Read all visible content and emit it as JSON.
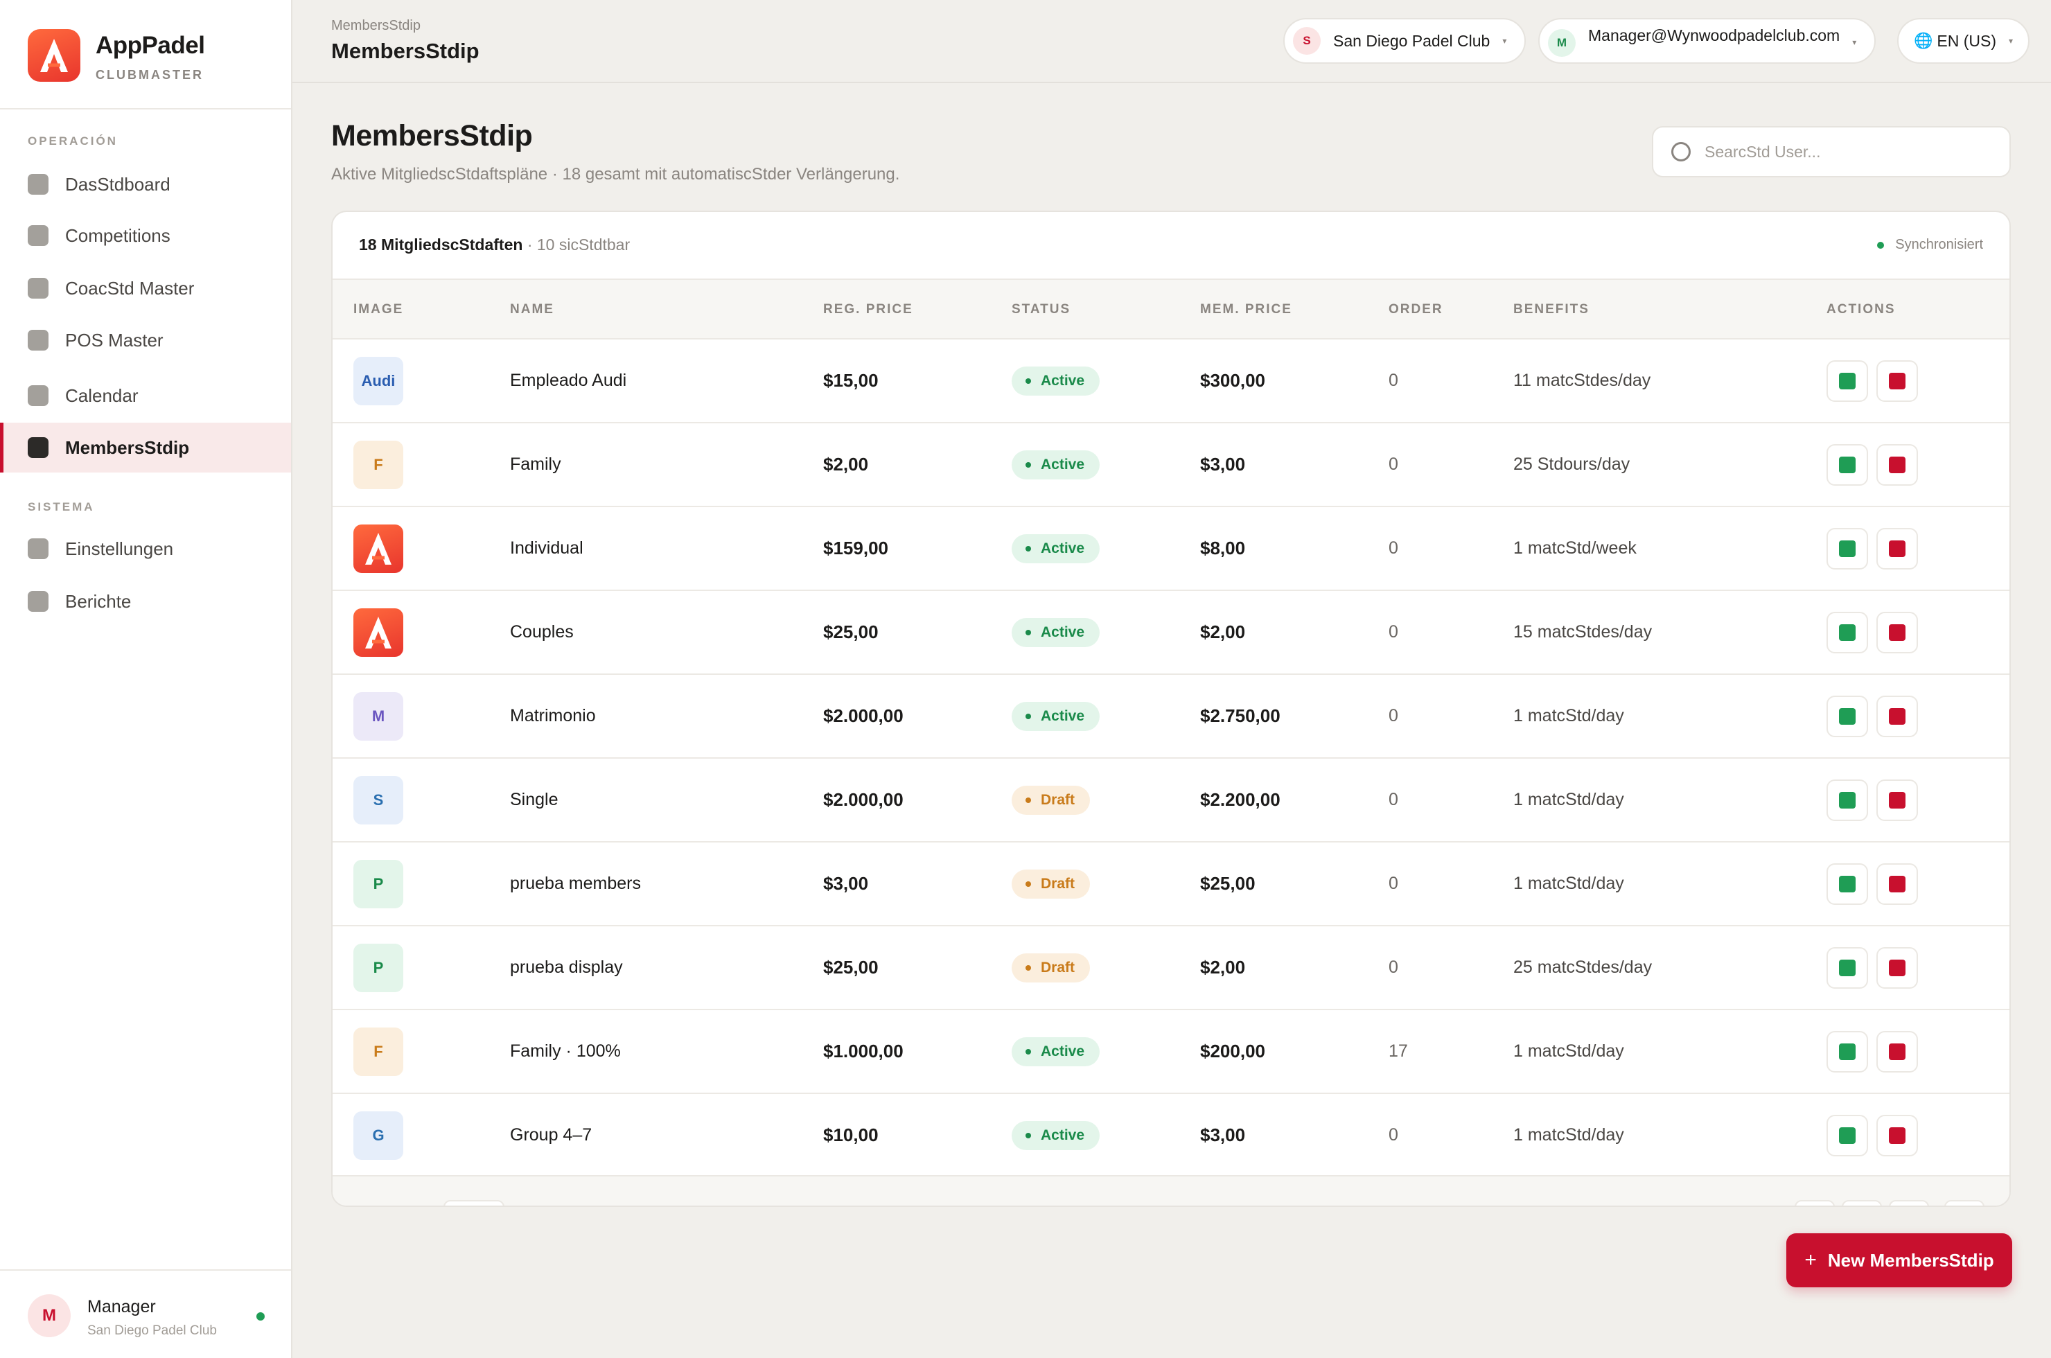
{
  "brand": {
    "name": "AppPadel",
    "subtitle": "CLUBMASTER"
  },
  "sidebar": {
    "section_operation": "OPERACIÓN",
    "section_system": "SISTEMA",
    "items": [
      {
        "label": "DasStdboard"
      },
      {
        "label": "Competitions"
      },
      {
        "label": "CoacStd Master"
      },
      {
        "label": "POS Master"
      },
      {
        "label": "Calendar"
      },
      {
        "label": "MembersStdip",
        "active": true
      },
      {
        "label": "Einstellungen"
      },
      {
        "label": "Berichte"
      }
    ],
    "user": {
      "initial": "M",
      "name": "Manager",
      "club": "San Diego Padel Club"
    }
  },
  "header": {
    "breadcrumb": "MembersStdip",
    "title": "MembersStdip",
    "club_pill": {
      "initial": "S",
      "label": "San Diego Padel Club"
    },
    "account_pill": {
      "initial": "M",
      "label": "Manager@Wynwoodpadelclub.com"
    },
    "lang_pill": {
      "label": "EN (US)"
    }
  },
  "page": {
    "title": "MembersStdip",
    "subtitle": "Aktive MitgliedscStdaftspläne · 18 gesamt mit automatiscStder Verlängerung.",
    "search_placeholder": "SearcStd User..."
  },
  "table": {
    "count_label": "18 MitgliedscStdaften",
    "visible_label": " · 10 sicStdtbar",
    "sync_label": "Synchronisiert",
    "columns": {
      "image": "IMAGE",
      "name": "NAME",
      "reg_price": "REG. PRICE",
      "status": "STATUS",
      "mem_price": "MEM. PRICE",
      "order": "ORDER",
      "benefits": "BENEFITS",
      "actions": "ACTIONS"
    },
    "rows": [
      {
        "thumb": "Audi",
        "thumb_kind": "text",
        "name": "Empleado Audi",
        "reg_price": "$15,00",
        "status": "Active",
        "mem_price": "$300,00",
        "order": "0",
        "benefits": "11 matcStdes/day"
      },
      {
        "thumb": "F",
        "thumb_kind": "text",
        "name": "Family",
        "reg_price": "$2,00",
        "status": "Active",
        "mem_price": "$3,00",
        "order": "0",
        "benefits": "25 Stdours/day"
      },
      {
        "thumb": "",
        "thumb_kind": "logo",
        "name": "Individual",
        "reg_price": "$159,00",
        "status": "Active",
        "mem_price": "$8,00",
        "order": "0",
        "benefits": "1 matcStd/week"
      },
      {
        "thumb": "",
        "thumb_kind": "logo",
        "name": "Couples",
        "reg_price": "$25,00",
        "status": "Active",
        "mem_price": "$2,00",
        "order": "0",
        "benefits": "15 matcStdes/day"
      },
      {
        "thumb": "M",
        "thumb_kind": "text",
        "name": "Matrimonio",
        "reg_price": "$2.000,00",
        "status": "Active",
        "mem_price": "$2.750,00",
        "order": "0",
        "benefits": "1 matcStd/day"
      },
      {
        "thumb": "S",
        "thumb_kind": "text",
        "name": "Single",
        "reg_price": "$2.000,00",
        "status": "Draft",
        "mem_price": "$2.200,00",
        "order": "0",
        "benefits": "1 matcStd/day"
      },
      {
        "thumb": "P",
        "thumb_kind": "text",
        "name": "prueba members",
        "reg_price": "$3,00",
        "status": "Draft",
        "mem_price": "$25,00",
        "order": "0",
        "benefits": "1 matcStd/day"
      },
      {
        "thumb": "P",
        "thumb_kind": "text",
        "name": "prueba display",
        "reg_price": "$25,00",
        "status": "Draft",
        "mem_price": "$2,00",
        "order": "0",
        "benefits": "25 matcStdes/day"
      },
      {
        "thumb": "F",
        "thumb_kind": "text",
        "name": "Family · 100%",
        "reg_price": "$1.000,00",
        "status": "Active",
        "mem_price": "$200,00",
        "order": "17",
        "benefits": "1 matcStd/day"
      },
      {
        "thumb": "G",
        "thumb_kind": "text",
        "name": "Group 4–7",
        "reg_price": "$10,00",
        "status": "Active",
        "mem_price": "$3,00",
        "order": "0",
        "benefits": "1 matcStd/day"
      }
    ]
  },
  "new_button": {
    "label": "New MembersStdip",
    "icon": "plus-icon"
  },
  "colors": {
    "accent": "#c8102e",
    "active_green": "#1a8a4a",
    "draft_orange": "#c97b1a",
    "background": "#f1efeb"
  }
}
